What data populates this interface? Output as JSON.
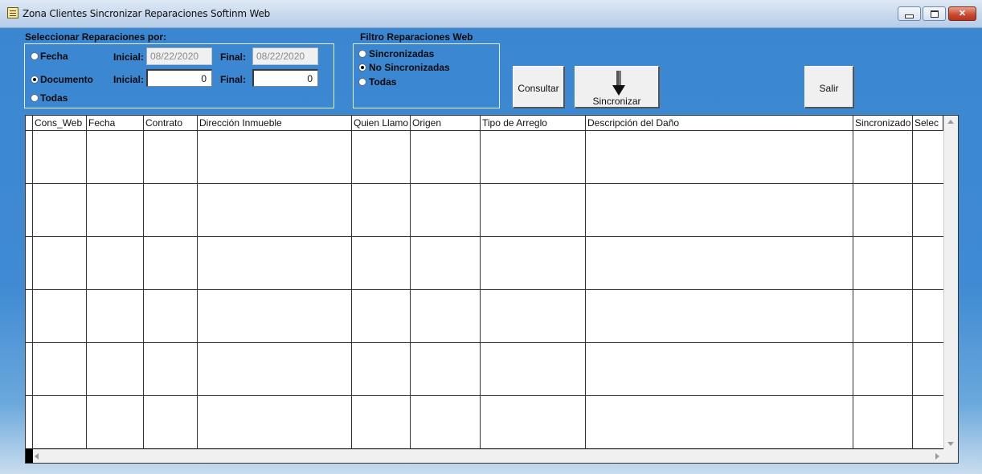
{
  "window": {
    "title": "Zona Clientes Sincronizar Reparaciones Softinm Web",
    "controls": [
      "minimize-icon",
      "maximize-icon",
      "close-icon"
    ],
    "close_glyph": "✕"
  },
  "select_group": {
    "title": "Seleccionar Reparaciones por:",
    "options": [
      {
        "label": "Fecha",
        "checked": false
      },
      {
        "label": "Documento",
        "checked": true
      },
      {
        "label": "Todas",
        "checked": false
      }
    ],
    "fecha_inicial_label": "Inicial:",
    "fecha_inicial_value": "08/22/2020",
    "fecha_final_label": "Final:",
    "fecha_final_value": "08/22/2020",
    "doc_inicial_label": "Inicial:",
    "doc_inicial_value": "0",
    "doc_final_label": "Final:",
    "doc_final_value": "0"
  },
  "filter_group": {
    "title": "Filtro Reparaciones Web",
    "options": [
      {
        "label": "Sincronizadas",
        "checked": false
      },
      {
        "label": "No Sincronizadas",
        "checked": true
      },
      {
        "label": "Todas",
        "checked": false
      }
    ]
  },
  "buttons": {
    "consultar": "Consultar",
    "sincronizar": "Sincronizar",
    "sincronizar_icon": "down-arrow-icon",
    "salir": "Salir"
  },
  "grid": {
    "columns": [
      "Cons_Web",
      "Fecha",
      "Contrato",
      "Dirección Inmueble",
      "Quien Llamo",
      "Origen",
      "Tipo de Arreglo",
      "Descripción del Daño",
      "Sincronizado",
      "Selec"
    ],
    "row_count": 6
  }
}
